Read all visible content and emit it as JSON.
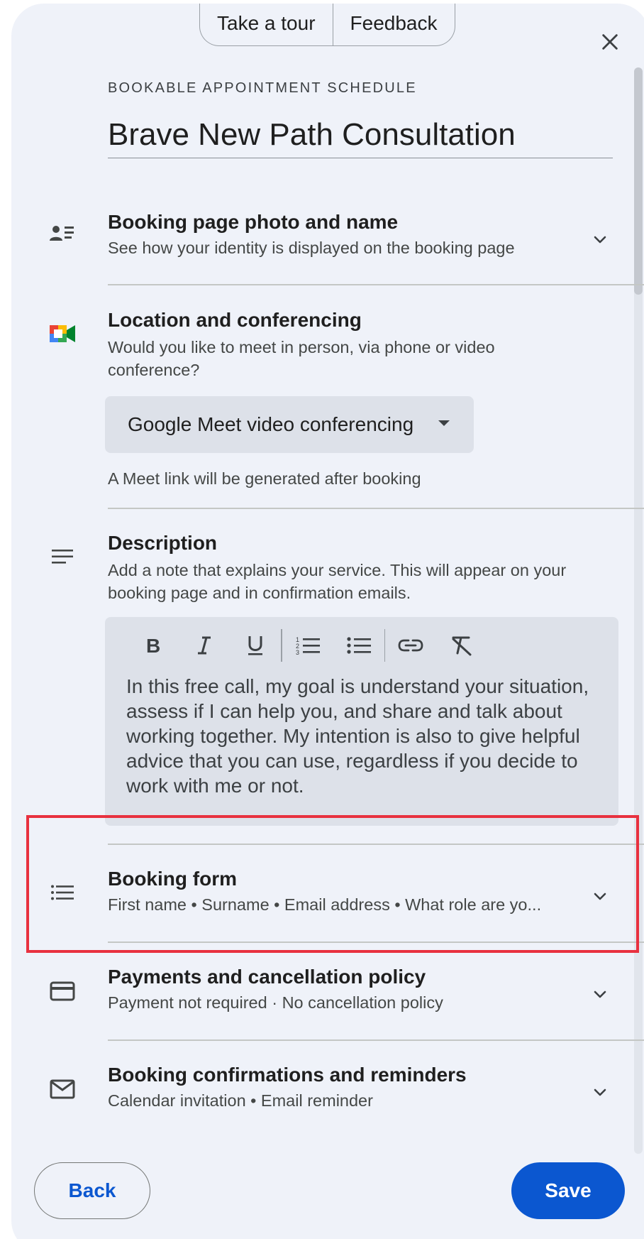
{
  "top_tabs": {
    "tour": "Take a tour",
    "feedback": "Feedback"
  },
  "header": {
    "eyebrow": "BOOKABLE APPOINTMENT SCHEDULE",
    "title": "Brave New Path Consultation"
  },
  "sections": {
    "booking_page": {
      "icon": "person-list-icon",
      "title": "Booking page photo and name",
      "subtitle": "See how your identity is displayed on the booking page"
    },
    "location": {
      "icon": "google-meet-icon",
      "title": "Location and conferencing",
      "subtitle": "Would you like to meet in person, via phone or video conference?",
      "selected_option": "Google Meet video conferencing",
      "hint": "A Meet link will be generated after booking"
    },
    "description": {
      "icon": "notes-icon",
      "title": "Description",
      "subtitle": "Add a note that explains your service. This will appear on your booking page and in confirmation emails.",
      "toolbar": [
        "bold-icon",
        "italic-icon",
        "underline-icon",
        "numbered-list-icon",
        "bulleted-list-icon",
        "link-icon",
        "clear-format-icon"
      ],
      "text": "In this free call, my goal is understand your situation, assess if I can help you, and share and talk about working together. My intention is also to give helpful advice that you can use, regardless if you decide to work with me or not."
    },
    "booking_form": {
      "icon": "list-icon",
      "title": "Booking form",
      "subtitle": "First name • Surname • Email address • What role are yo..."
    },
    "payments": {
      "icon": "credit-card-icon",
      "title": "Payments and cancellation policy",
      "subtitle": "Payment not required · No cancellation policy"
    },
    "confirmations": {
      "icon": "mail-icon",
      "title": "Booking confirmations and reminders",
      "subtitle": "Calendar invitation • Email reminder"
    }
  },
  "footer": {
    "back": "Back",
    "save": "Save"
  },
  "colors": {
    "panel_bg": "#eff2f9",
    "accent": "#0b57d0",
    "highlight": "#e8313f"
  }
}
